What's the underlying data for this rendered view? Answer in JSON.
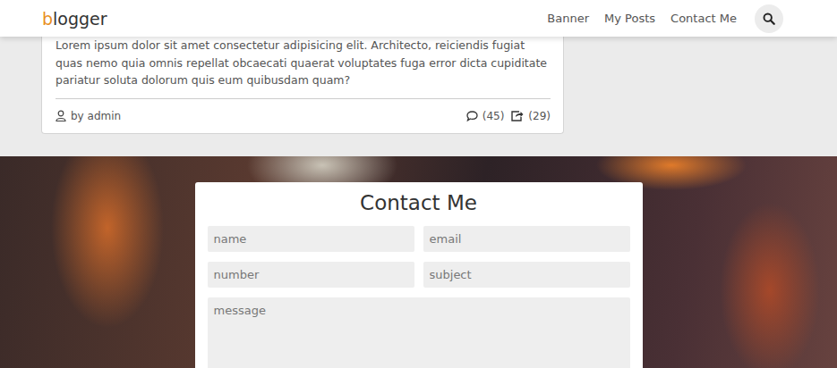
{
  "header": {
    "logo": {
      "accent": "b",
      "rest": "logger"
    },
    "nav": [
      {
        "label": "Banner"
      },
      {
        "label": "My Posts"
      },
      {
        "label": "Contact Me"
      }
    ]
  },
  "post": {
    "excerpt": "Lorem ipsum dolor sit amet consectetur adipisicing elit. Architecto, reiciendis fugiat quas nemo quia omnis repellat obcaecati quaerat voluptates fuga error dicta cupiditate pariatur soluta dolorum quis eum quibusdam quam?",
    "author": "by admin",
    "comments": "(45)",
    "shares": "(29)"
  },
  "contact": {
    "title": "Contact Me",
    "fields": [
      {
        "placeholder": "name",
        "kind": "input"
      },
      {
        "placeholder": "email",
        "kind": "input"
      },
      {
        "placeholder": "number",
        "kind": "input"
      },
      {
        "placeholder": "subject",
        "kind": "input"
      },
      {
        "placeholder": "message",
        "kind": "textarea"
      }
    ]
  }
}
